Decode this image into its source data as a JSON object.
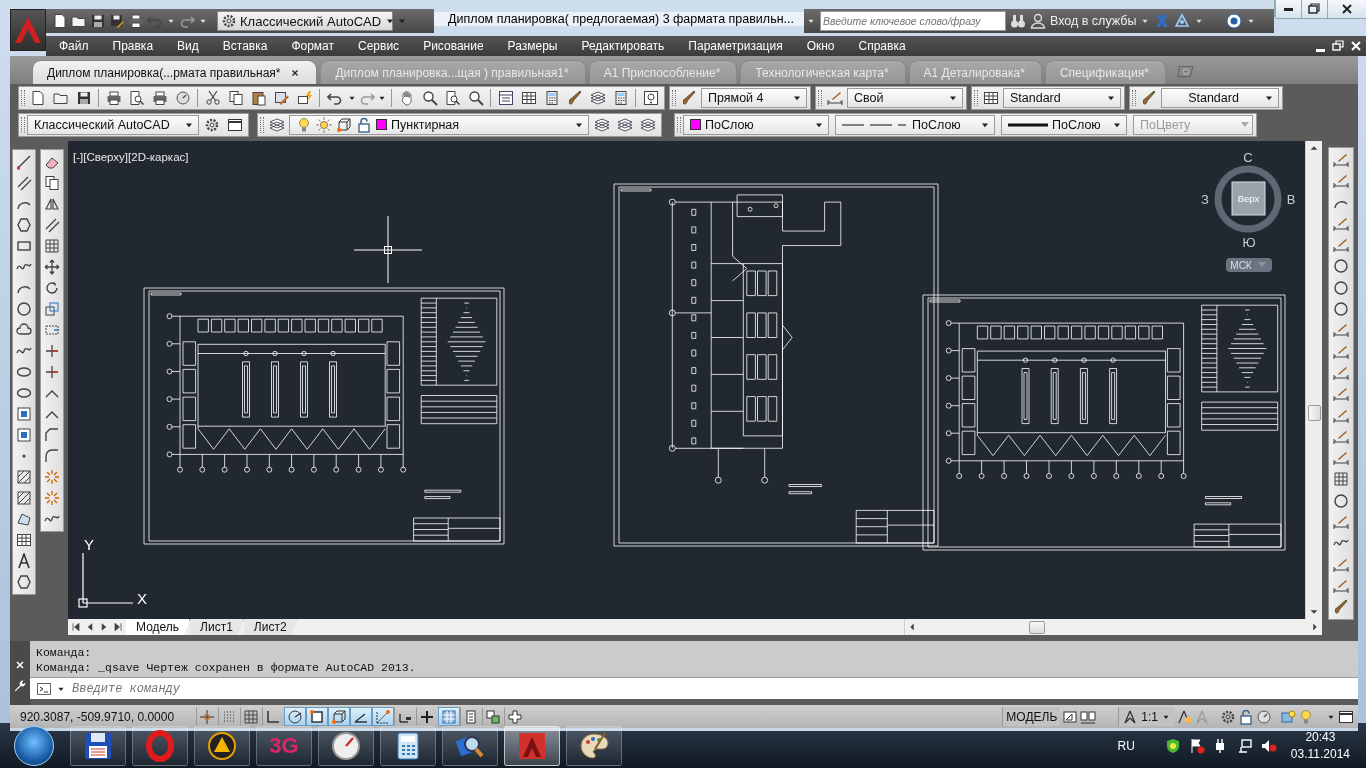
{
  "window": {
    "title": "Диплом планировка( предлогаемая) 3 фармата правильн..."
  },
  "quick_access": {
    "workspace": "Классический AutoCAD"
  },
  "search": {
    "placeholder": "Введите ключевое слово/фразу"
  },
  "sign_in": "Вход в службы",
  "menu": [
    "Файл",
    "Правка",
    "Вид",
    "Вставка",
    "Формат",
    "Сервис",
    "Рисование",
    "Размеры",
    "Редактировать",
    "Параметризация",
    "Окно",
    "Справка"
  ],
  "doc_tabs": [
    {
      "label": "Диплом планировка(...рмата правильная*",
      "selected": true
    },
    {
      "label": "Диплом планировка...щая ) правильная1*",
      "selected": false
    },
    {
      "label": "A1 Приспособление*",
      "selected": false
    },
    {
      "label": "Технологическая карта*",
      "selected": false
    },
    {
      "label": "A1 Деталировака*",
      "selected": false
    },
    {
      "label": "Спецификация*",
      "selected": false
    }
  ],
  "styles": {
    "text_style": "Прямой 4",
    "dim_style": "Свой",
    "table_style": "Standard",
    "multileader_style": "Standard"
  },
  "workspace_toolbar": {
    "workspace": "Классический AutoCAD"
  },
  "layer": {
    "name": "Пунктирная",
    "color": "#ff00ff"
  },
  "properties": {
    "color": {
      "label": "ПоСлою",
      "color": "#ff00ff"
    },
    "linetype": "ПоСлою",
    "lineweight": "ПоСлою",
    "plot_style": {
      "label": "ПоЦвету",
      "disabled": true
    }
  },
  "viewport": {
    "label": "[-][Сверху][2D-каркас]"
  },
  "viewcube": {
    "north": "С",
    "east": "В",
    "south": "Ю",
    "west": "З",
    "face": "Верх",
    "ucs": "МСК"
  },
  "ucs_axes": {
    "x": "X",
    "y": "Y"
  },
  "layout_tabs": [
    {
      "label": "Модель",
      "selected": true
    },
    {
      "label": "Лист1",
      "selected": false
    },
    {
      "label": "Лист2",
      "selected": false
    }
  ],
  "command": {
    "history": [
      "Команда:",
      "Команда: _qsave Чертеж сохранен в формате AutoCAD 2013."
    ],
    "placeholder": "Введите команду"
  },
  "status_bar": {
    "coordinates": "920.3087, -509.9710, 0.0000",
    "toggles": [
      {
        "on": false
      },
      {
        "on": false
      },
      {
        "on": false
      },
      {
        "on": false
      },
      {
        "on": true
      },
      {
        "on": true
      },
      {
        "on": true
      },
      {
        "on": true
      },
      {
        "on": true
      },
      {
        "on": false
      },
      {
        "on": false
      },
      {
        "on": true
      },
      {
        "on": false
      },
      {
        "on": false
      },
      {
        "on": false
      }
    ],
    "space": "МОДЕЛЬ",
    "annotation_scale": "1:1"
  },
  "taskbar": {
    "apps": [
      {
        "kind": "floppy",
        "selected": false
      },
      {
        "kind": "ring",
        "selected": false
      },
      {
        "kind": "triangle",
        "selected": false
      },
      {
        "kind": "text",
        "label": "3G",
        "selected": false
      },
      {
        "kind": "gauge",
        "selected": false
      },
      {
        "kind": "calculator",
        "selected": false
      },
      {
        "kind": "magnifier",
        "selected": false
      },
      {
        "kind": "cad",
        "selected": true
      },
      {
        "kind": "palette",
        "selected": false
      }
    ],
    "language": "RU",
    "time": "20:43",
    "date": "03.11.2014"
  }
}
